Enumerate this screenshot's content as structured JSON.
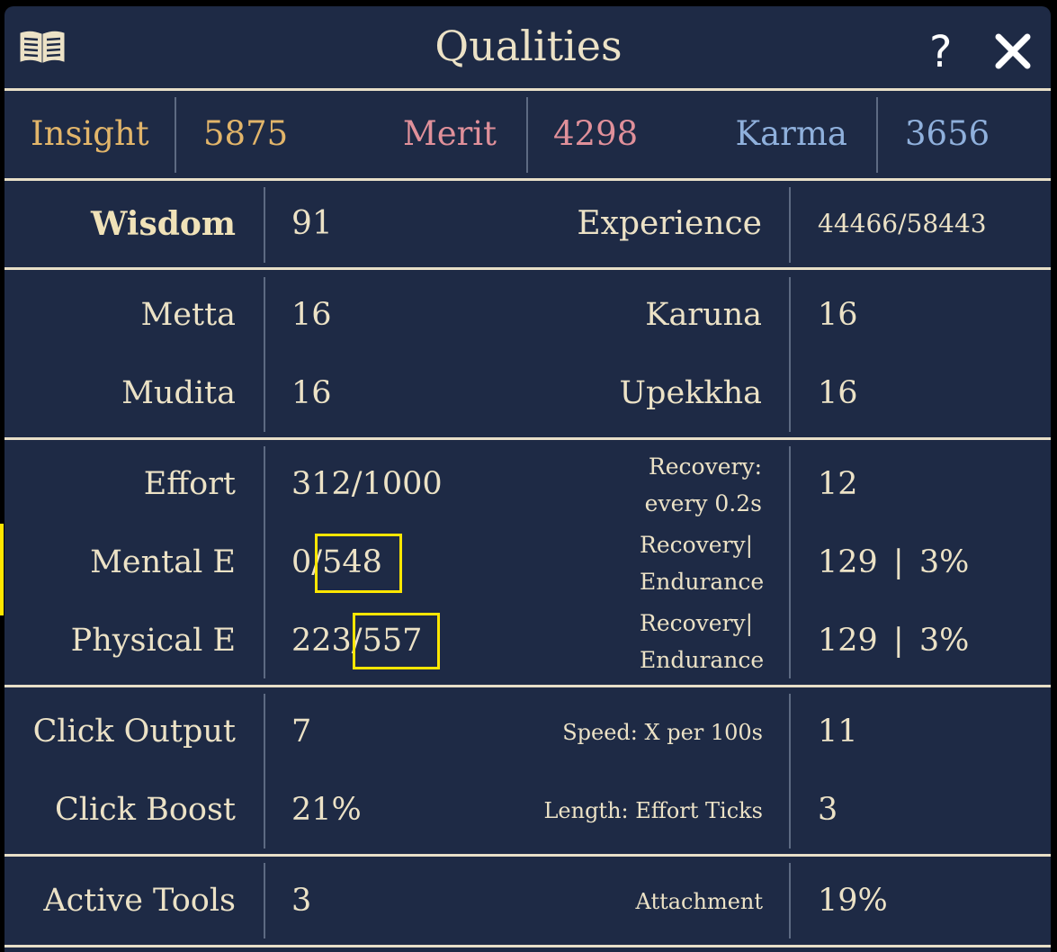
{
  "header": {
    "title": "Qualities",
    "help_label": "?",
    "icons": {
      "book": "book-icon",
      "close": "close-icon"
    }
  },
  "resources": {
    "insight": {
      "label": "Insight",
      "value": "5875",
      "color": "#e2b56a"
    },
    "merit": {
      "label": "Merit",
      "value": "4298",
      "color": "#e0909a"
    },
    "karma": {
      "label": "Karma",
      "value": "3656",
      "color": "#8fb0dc"
    }
  },
  "wisdom": {
    "label": "Wisdom",
    "value": "91",
    "exp_label": "Experience",
    "exp_value": "44466/58443"
  },
  "virtues": [
    {
      "label": "Metta",
      "value": "16",
      "label2": "Karuna",
      "value2": "16"
    },
    {
      "label": "Mudita",
      "value": "16",
      "label2": "Upekkha",
      "value2": "16"
    }
  ],
  "energy": {
    "effort": {
      "label": "Effort",
      "value": "312/1000",
      "sub1": "Recovery:",
      "sub2": "every 0.2s",
      "value2": "12"
    },
    "mental": {
      "label": "Mental E",
      "value_a": "0/",
      "value_b": "548",
      "sub1": "Recovery|",
      "sub2": "Endurance",
      "value2": "129 | 3%"
    },
    "physical": {
      "label": "Physical E",
      "value_a": "223/",
      "value_b": "557",
      "sub1": "Recovery|",
      "sub2": "Endurance",
      "value2": "129 | 3%"
    }
  },
  "clicks": {
    "output": {
      "label": "Click Output",
      "value": "7",
      "sub": "Speed: X per 100s",
      "value2": "11"
    },
    "boost": {
      "label": "Click Boost",
      "value": "21%",
      "sub": "Length: Effort Ticks",
      "value2": "3"
    }
  },
  "tools": {
    "label": "Active Tools",
    "value": "3",
    "sub": "Attachment",
    "value2": "19%"
  },
  "highlight_color": "#ffe600"
}
